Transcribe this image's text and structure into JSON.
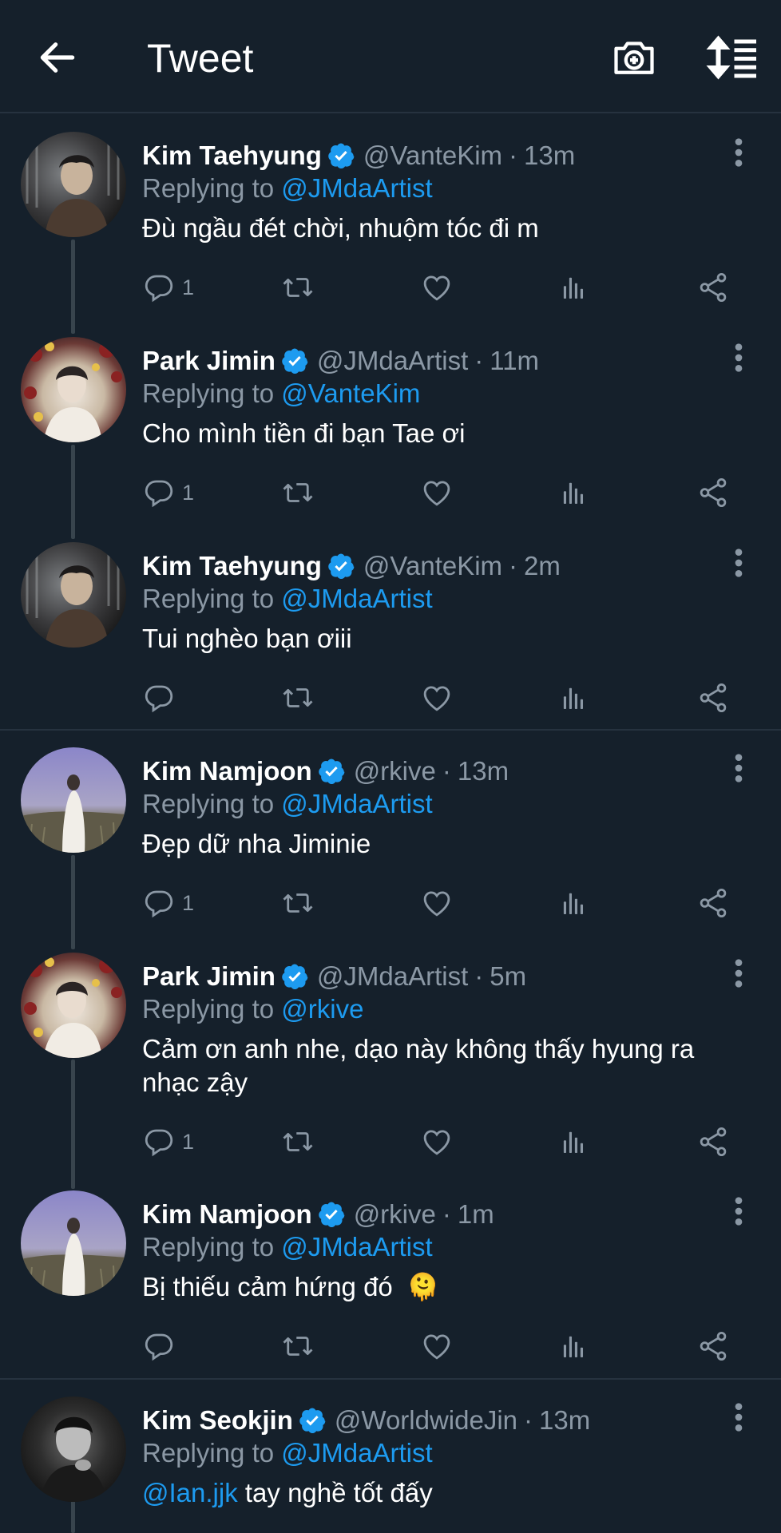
{
  "header": {
    "title": "Tweet",
    "back_icon": "arrow-left-icon",
    "camera_icon": "camera-plus-icon",
    "sort_icon": "sort-icon"
  },
  "colors": {
    "background": "#15202b",
    "accent": "#1d9bf0",
    "muted": "#8b98a5",
    "divider": "#26323f",
    "thread": "#38444d"
  },
  "tweets": [
    {
      "name": "Kim Taehyung",
      "handle": "@VanteKim",
      "time": "13m",
      "reply_prefix": "Replying to",
      "reply_to": "@JMdaArtist",
      "text": "Đù ngầu đét chời, nhuộm tóc đi m",
      "reply_count": "1"
    },
    {
      "name": "Park Jimin",
      "handle": "@JMdaArtist",
      "time": "11m",
      "reply_prefix": "Replying to",
      "reply_to": "@VanteKim",
      "text": "Cho mình tiền đi bạn Tae ơi",
      "reply_count": "1"
    },
    {
      "name": "Kim Taehyung",
      "handle": "@VanteKim",
      "time": "2m",
      "reply_prefix": "Replying to",
      "reply_to": "@JMdaArtist",
      "text": "Tui nghèo bạn ơiii",
      "reply_count": ""
    },
    {
      "name": "Kim Namjoon",
      "handle": "@rkive",
      "time": "13m",
      "reply_prefix": "Replying to",
      "reply_to": "@JMdaArtist",
      "text": "Đẹp dữ nha Jiminie",
      "reply_count": "1"
    },
    {
      "name": "Park Jimin",
      "handle": "@JMdaArtist",
      "time": "5m",
      "reply_prefix": "Replying to",
      "reply_to": "@rkive",
      "text_line1": "Cảm ơn anh nhe, dạo này không thấy hyung ra",
      "text_line2": "nhạc zậy",
      "reply_count": "1"
    },
    {
      "name": "Kim Namjoon",
      "handle": "@rkive",
      "time": "1m",
      "reply_prefix": "Replying to",
      "reply_to": "@JMdaArtist",
      "text": "Bị thiếu cảm hứng đó",
      "emoji": "🫠",
      "reply_count": ""
    },
    {
      "name": "Kim Seokjin",
      "handle": "@WorldwideJin",
      "time": "13m",
      "reply_prefix": "Replying to",
      "reply_to": "@JMdaArtist",
      "text_mention": "@Ian.jjk",
      "text": " tay nghề tốt đấy",
      "reply_count": ""
    }
  ],
  "separator": "·",
  "icons": [
    "comment-icon",
    "retweet-icon",
    "like-icon",
    "analytics-icon",
    "share-icon",
    "more-vertical-icon",
    "verified-badge-icon"
  ]
}
